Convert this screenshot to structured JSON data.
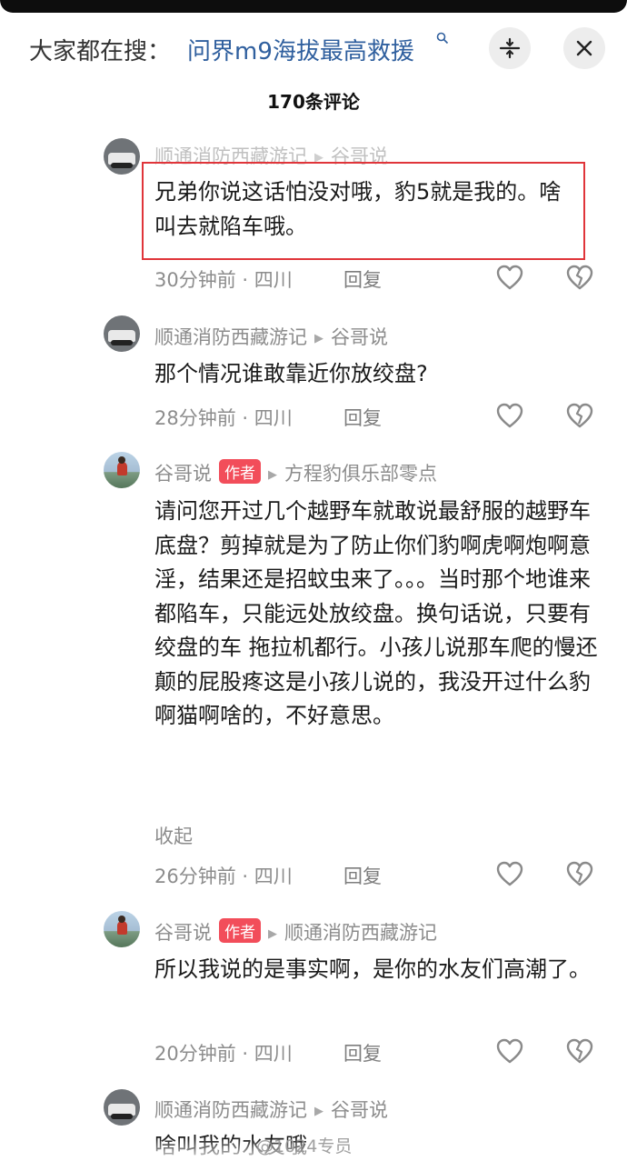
{
  "search": {
    "prefix": "大家都在搜：",
    "query": "问界m9海拔最高救援",
    "query_icon": "search-icon"
  },
  "header": {
    "collapse_icon": "collapse-icon",
    "close_icon": "close-icon",
    "comment_count": "170条评论"
  },
  "comments": [
    {
      "user": "顺通消防西藏游记",
      "reply_to": "谷哥说",
      "text": "兄弟你说这话怕没对哦，豹5就是我的。啥叫去就陷车哦。",
      "time": "30分钟前 · 四川",
      "reply_label": "回复"
    },
    {
      "user": "顺通消防西藏游记",
      "reply_to": "谷哥说",
      "text": "那个情况谁敢靠近你放绞盘?",
      "time": "28分钟前 · 四川",
      "reply_label": "回复"
    },
    {
      "user": "谷哥说",
      "badge": "作者",
      "reply_to": "方程豹俱乐部零点",
      "text": "请问您开过几个越野车就敢说最舒服的越野车底盘？剪掉就是为了防止你们豹啊虎啊炮啊意淫，结果还是招蚊虫来了。。。当时那个地谁来都陷车，只能远处放绞盘。换句话说，只要有绞盘的车 拖拉机都行。小孩儿说那车爬的慢还颠的屁股疼这是小孩儿说的，我没开过什么豹啊猫啊啥的，不好意思。",
      "fold_label": "收起",
      "time": "26分钟前 · 四川",
      "reply_label": "回复"
    },
    {
      "user": "谷哥说",
      "badge": "作者",
      "reply_to": "顺通消防西藏游记",
      "text": "所以我说的是事实啊，是你的水友们高潮了。",
      "time": "20分钟前 · 四川",
      "reply_label": "回复"
    },
    {
      "user": "顺通消防西藏游记",
      "reply_to": "谷哥说",
      "text": "啥叫我的水友哦"
    }
  ],
  "actions": {
    "like_icon": "heart-icon",
    "dislike_icon": "broken-heart-icon"
  },
  "watermark": "@1024专员",
  "colors": {
    "link": "#2f5f9e",
    "author_badge": "#f24d5a",
    "highlight_box": "#e0353a",
    "meta_gray": "#8c8c8c"
  }
}
